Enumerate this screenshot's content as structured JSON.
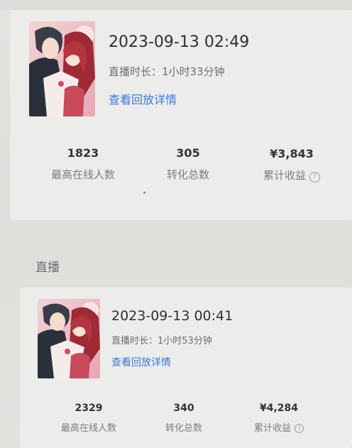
{
  "sessions": [
    {
      "datetime": "2023-09-13 02:49",
      "duration": "直播时长：1小时33分钟",
      "replay_link": "查看回放详情",
      "stats": [
        {
          "value": "1823",
          "label": "最高在线人数"
        },
        {
          "value": "305",
          "label": "转化总数"
        },
        {
          "value": "¥3,843",
          "label": "累计收益"
        }
      ]
    },
    {
      "section_label": "直播",
      "datetime": "2023-09-13 00:41",
      "duration": "直播时长：1小时53分钟",
      "replay_link": "查看回放详情",
      "stats": [
        {
          "value": "2329",
          "label": "最高在线人数"
        },
        {
          "value": "340",
          "label": "转化总数"
        },
        {
          "value": "¥4,284",
          "label": "累计收益"
        }
      ]
    }
  ],
  "icons": {
    "help": "question-circle-icon"
  },
  "colors": {
    "link": "#3b78d8",
    "text": "#2f2f2f",
    "muted": "#7d7d7d"
  }
}
